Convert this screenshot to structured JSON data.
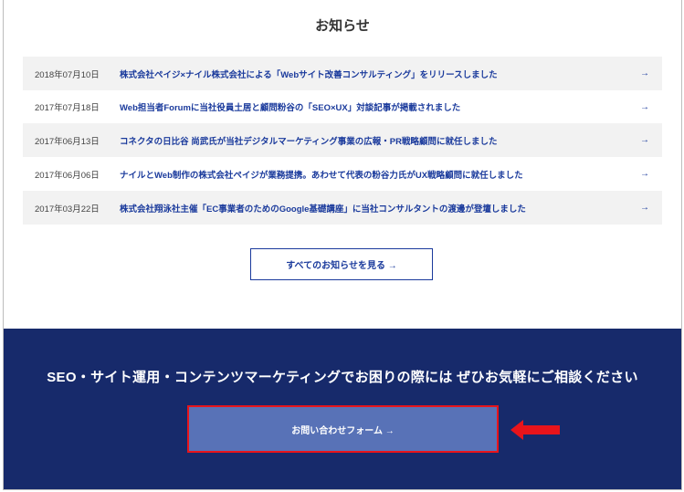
{
  "news": {
    "title": "お知らせ",
    "items": [
      {
        "date": "2018年07月10日",
        "text": "株式会社ペイジ×ナイル株式会社による「Webサイト改善コンサルティング」をリリースしました",
        "arrow": "→"
      },
      {
        "date": "2017年07月18日",
        "text": "Web担当者Forumに当社役員土居と顧問粉谷の「SEO×UX」対談記事が掲載されました",
        "arrow": "→"
      },
      {
        "date": "2017年06月13日",
        "text": "コネクタの日比谷 尚武氏が当社デジタルマーケティング事業の広報・PR戦略顧問に就任しました",
        "arrow": "→"
      },
      {
        "date": "2017年06月06日",
        "text": "ナイルとWeb制作の株式会社ペイジが業務提携。あわせて代表の粉谷力氏がUX戦略顧問に就任しました",
        "arrow": "→"
      },
      {
        "date": "2017年03月22日",
        "text": "株式会社翔泳社主催「EC事業者のためのGoogle基礎講座」に当社コンサルタントの渡邊が登壇しました",
        "arrow": "→"
      }
    ],
    "all_button_label": "すべてのお知らせを見る →"
  },
  "cta": {
    "heading": "SEO・サイト運用・コンテンツマーケティングでお困りの際には ぜひお気軽にご相談ください",
    "contact_button_label": "お問い合わせフォーム →"
  },
  "colors": {
    "accent": "#1a3a9c",
    "cta_background": "#172a6b",
    "button_fill": "#5872b7",
    "highlight": "#e8141b"
  },
  "icons": {
    "row_arrow": "arrow-right-icon",
    "pointer": "red-pointer-arrow-icon"
  }
}
